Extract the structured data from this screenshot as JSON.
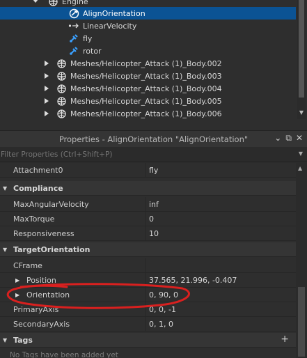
{
  "explorer": {
    "items": [
      {
        "label": "Engine",
        "icon": "globe-icon",
        "expanded": true,
        "indent": 1
      },
      {
        "label": "AlignOrientation",
        "icon": "align-orientation-icon",
        "selected": true,
        "indent": 2
      },
      {
        "label": "LinearVelocity",
        "icon": "linear-velocity-icon",
        "indent": 2
      },
      {
        "label": "fly",
        "icon": "attachment-icon",
        "indent": 2
      },
      {
        "label": "rotor",
        "icon": "attachment-icon",
        "indent": 2
      },
      {
        "label": "Meshes/Helicopter_Attack (1)_Body.002",
        "icon": "globe-icon",
        "indent": 1
      },
      {
        "label": "Meshes/Helicopter_Attack (1)_Body.003",
        "icon": "globe-icon",
        "indent": 1
      },
      {
        "label": "Meshes/Helicopter_Attack (1)_Body.004",
        "icon": "globe-icon",
        "indent": 1
      },
      {
        "label": "Meshes/Helicopter_Attack (1)_Body.005",
        "icon": "globe-icon",
        "indent": 1
      },
      {
        "label": "Meshes/Helicopter_Attack (1)_Body.006",
        "icon": "globe-icon",
        "indent": 1
      }
    ]
  },
  "properties": {
    "title": "Properties - AlignOrientation \"AlignOrientation\"",
    "filter_placeholder": "Filter Properties (Ctrl+Shift+P)",
    "rows": [
      {
        "type": "prop",
        "name": "Attachment0",
        "value": "fly"
      },
      {
        "type": "category",
        "name": "Compliance"
      },
      {
        "type": "prop",
        "name": "MaxAngularVelocity",
        "value": "inf"
      },
      {
        "type": "prop",
        "name": "MaxTorque",
        "value": "0"
      },
      {
        "type": "prop",
        "name": "Responsiveness",
        "value": "10"
      },
      {
        "type": "category",
        "name": "TargetOrientation"
      },
      {
        "type": "prop",
        "name": "CFrame",
        "value": ""
      },
      {
        "type": "subprop",
        "name": "Position",
        "value": "37.565, 21.996, -0.407"
      },
      {
        "type": "subprop",
        "name": "Orientation",
        "value": "0, 90, 0"
      },
      {
        "type": "prop",
        "name": "PrimaryAxis",
        "value": "0, 0, -1"
      },
      {
        "type": "prop",
        "name": "SecondaryAxis",
        "value": "0, 1, 0"
      },
      {
        "type": "category",
        "name": "Tags"
      }
    ],
    "tags_empty": "No Tags have been added yet"
  },
  "colors": {
    "selection": "#0b5394",
    "annotation": "#d9201f"
  }
}
